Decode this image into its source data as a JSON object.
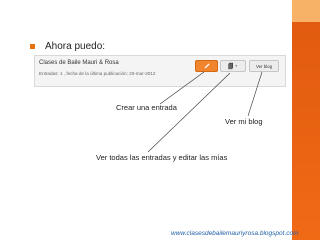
{
  "heading": {
    "bullet_text": "Ahora puedo:"
  },
  "blog_panel": {
    "title": "Clases de Baile Mauri & Rosa",
    "meta": "Entradas: 1 , fecha de la última publicación: 20-mar-2012",
    "view_blog_label": "Ver blog"
  },
  "annotations": {
    "create_post": "Crear una entrada",
    "view_blog": "Ver mi blog",
    "view_edit_posts": "Ver todas las entradas y editar las mías"
  },
  "footer": {
    "url": "www.clasesdebailemauriyrosa.blogspot.com"
  },
  "colors": {
    "accent": "#f06a16",
    "link": "#1f5fa6"
  },
  "icons": {
    "create": "pencil-icon",
    "posts": "document-icon"
  }
}
